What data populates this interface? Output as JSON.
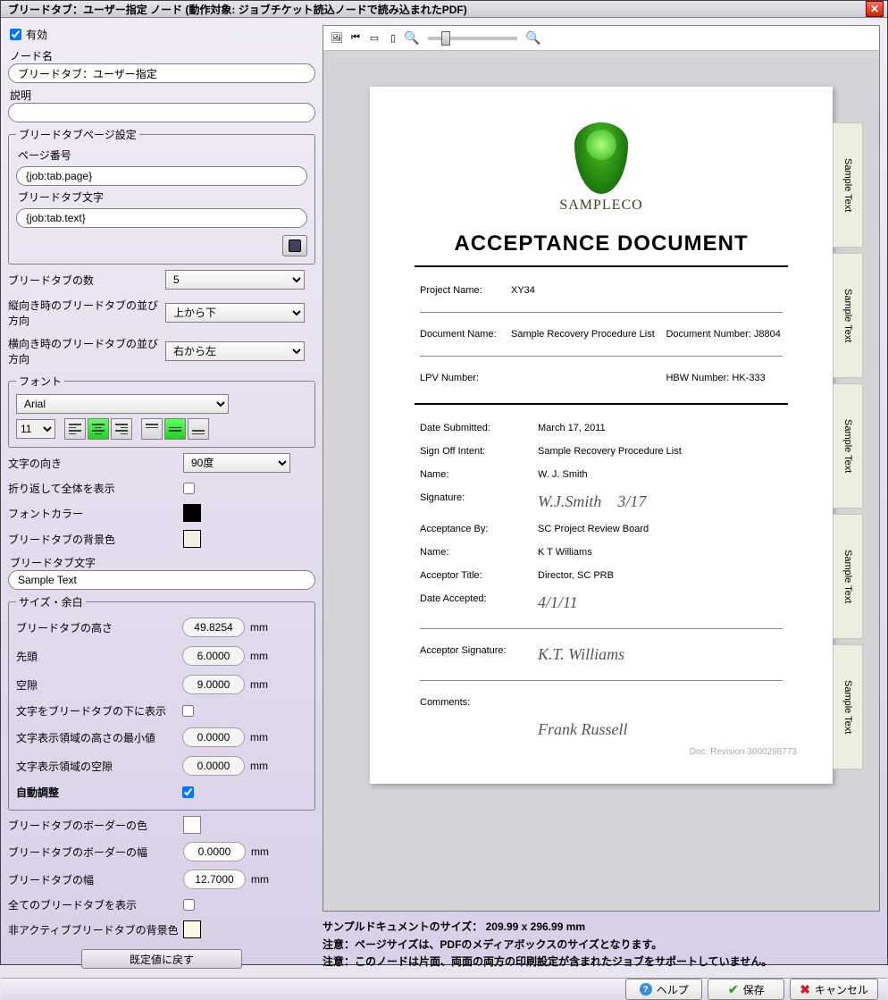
{
  "window": {
    "title": "ブリードタブ：ユーザー指定 ノード (動作対象: ジョブチケット読込ノードで読み込まれたPDF)"
  },
  "left": {
    "enable_label": "有効",
    "nodename_label": "ノード名",
    "nodename_value": "ブリードタブ：ユーザー指定",
    "desc_label": "説明",
    "desc_value": "",
    "page_settings_legend": "ブリードタブページ設定",
    "page_number_label": "ページ番号",
    "page_number_value": "{job:tab.page}",
    "bleedtab_text_label": "ブリードタブ文字",
    "bleedtab_text_field_value": "{job:tab.text}",
    "count_label": "ブリードタブの数",
    "count_value": "5",
    "vdir_label": "縦向き時のブリードタブの並び方向",
    "vdir_value": "上から下",
    "hdir_label": "横向き時のブリードタブの並び方向",
    "hdir_value": "右から左",
    "font_legend": "フォント",
    "font_value": "Arial",
    "font_size_value": "11",
    "text_dir_label": "文字の向き",
    "text_dir_value": "90度",
    "wrap_label": "折り返して全体を表示",
    "font_color_label": "フォントカラー",
    "bg_color_label": "ブリードタブの背景色",
    "bleedtext_label": "ブリードタブ文字",
    "bleedtext_value": "Sample Text",
    "size_legend": "サイズ・余白",
    "height_label": "ブリードタブの高さ",
    "height_value": "49.8254",
    "lead_label": "先頭",
    "lead_value": "6.0000",
    "gap_label": "空隙",
    "gap_value": "9.0000",
    "below_label": "文字をブリードタブの下に表示",
    "min_height_label": "文字表示領域の高さの最小値",
    "min_height_value": "0.0000",
    "text_gap_label": "文字表示領域の空隙",
    "text_gap_value": "0.0000",
    "auto_label": "自動調整",
    "border_color_label": "ブリードタブのボーダーの色",
    "border_width_label": "ブリードタブのボーダーの幅",
    "border_width_value": "0.0000",
    "tab_width_label": "ブリードタブの幅",
    "tab_width_value": "12.7000",
    "show_all_label": "全てのブリードタブを表示",
    "inactive_bg_label": "非アクティブブリードタブの背景色",
    "unit_mm": "mm",
    "reset_label": "既定値に戻す"
  },
  "preview": {
    "logo_text": "SAMPLECO",
    "title": "ACCEPTANCE DOCUMENT",
    "project_label": "Project Name:",
    "project_value": "XY34",
    "docname_label": "Document Name:",
    "docname_value": "Sample Recovery Procedure List",
    "docnum_label": "Document Number: J8804",
    "lpv_label": "LPV Number:",
    "hbw_label": "HBW Number: HK-333",
    "date_label": "Date Submitted:",
    "date_value": "March 17, 2011",
    "signoff_label": "Sign Off Intent:",
    "signoff_value": "Sample Recovery Procedure List",
    "name_label": "Name:",
    "name_value": "W. J. Smith",
    "sig_label": "Signature:",
    "accby_label": "Acceptance By:",
    "accby_value": "SC Project Review Board",
    "name2_value": "K T Williams",
    "acctitle_label": "Acceptor Title:",
    "acctitle_value": "Director, SC PRB",
    "dateacc_label": "Date Accepted:",
    "accsig_label": "Acceptor Signature:",
    "comments_label": "Comments:",
    "revision": "Doc. Revision 3000298773",
    "tab_text": "Sample Text"
  },
  "notes": {
    "size": "サンプルドキュメントのサイズ： 209.99 x 296.99 mm",
    "note1": "注意：ページサイズは、PDFのメディアボックスのサイズとなります。",
    "note2": "注意：このノードは片面、両面の両方の印刷設定が含まれたジョブをサポートしていません。"
  },
  "footer": {
    "help": "ヘルプ",
    "save": "保存",
    "cancel": "キャンセル"
  }
}
